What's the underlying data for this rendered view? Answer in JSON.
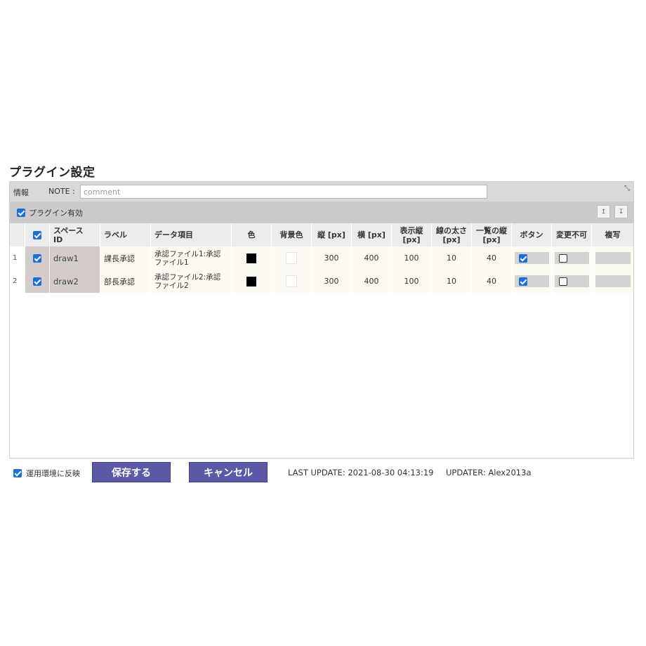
{
  "page_title": "プラグイン設定",
  "info": {
    "label": "情報",
    "note_label": "NOTE :",
    "note_placeholder": "comment",
    "note_value": "",
    "expand_icon": "⤡"
  },
  "plugin_enabled": {
    "label": "プラグイン有効",
    "checked": true
  },
  "toolbar": {
    "move_up_icon": "↥",
    "move_down_icon": "↧"
  },
  "table": {
    "columns": [
      "",
      "",
      "スペース\nID",
      "ラベル",
      "データ項目",
      "色",
      "背景色",
      "縦 [px]",
      "横 [px]",
      "表示縦\n[px]",
      "線の太さ\n[px]",
      "一覧の縦\n[px]",
      "ボタン",
      "変更不可",
      "複写"
    ],
    "rows": [
      {
        "num": "1",
        "selected": true,
        "space_id": "draw1",
        "label": "課長承認",
        "data_item": "承認ファイル1:承認\nファイル1",
        "color": "#000000",
        "bg_color": "#ffffff",
        "height": "300",
        "width": "400",
        "display_height": "100",
        "line_width": "10",
        "list_height": "40",
        "button": true,
        "readonly": false,
        "copy": ""
      },
      {
        "num": "2",
        "selected": true,
        "space_id": "draw2",
        "label": "部長承認",
        "data_item": "承認ファイル2:承認\nファイル2",
        "color": "#000000",
        "bg_color": "#ffffff",
        "height": "300",
        "width": "400",
        "display_height": "100",
        "line_width": "10",
        "list_height": "40",
        "button": true,
        "readonly": false,
        "copy": ""
      }
    ]
  },
  "footer": {
    "apply_label": "運用環境に反映",
    "apply_checked": true,
    "save_label": "保存する",
    "cancel_label": "キャンセル",
    "last_update": "LAST UPDATE: 2021-08-30 04:13:19",
    "updater": "UPDATER: Alex2013a"
  },
  "colors": {
    "button_bg": "#5c5aa6",
    "checkbox_blue": "#1a6fd8",
    "id_column_bg": "#d4cccb",
    "header_bg": "#ececec"
  }
}
